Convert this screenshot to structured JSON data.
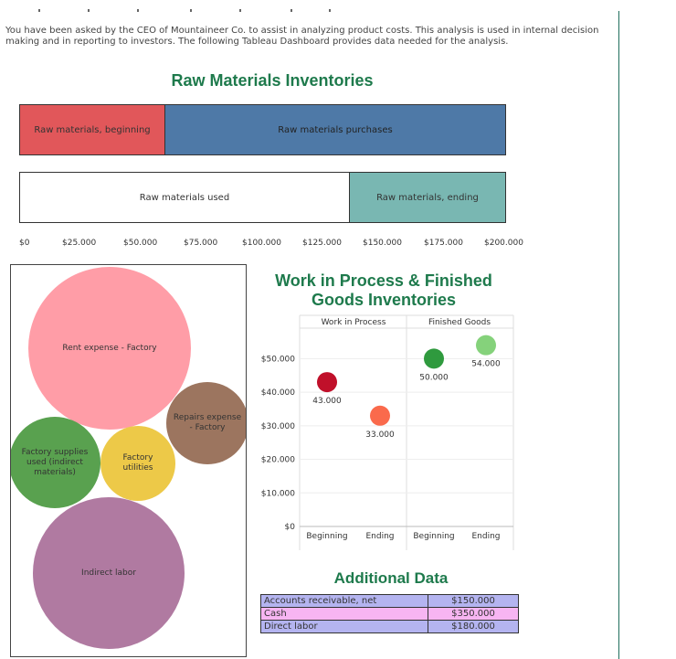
{
  "intro_text": "You have been asked by the CEO of Mountaineer Co. to assist in analyzing product costs. This analysis is used in internal decision making and in reporting to investors. The following Tableau Dashboard provides data needed for the analysis.",
  "raw_materials": {
    "title": "Raw Materials Inventories",
    "row1": {
      "left_label": "Raw materials, beginning",
      "right_label": "Raw materials purchases"
    },
    "row2": {
      "left_label": "Raw materials used",
      "right_label": "Raw materials, ending"
    },
    "colors": {
      "beginning": "#e1575a",
      "purchases": "#4e79a7",
      "used": "#ffffff",
      "ending": "#79b7b2"
    },
    "axis_ticks": [
      "$0",
      "$25.000",
      "$50.000",
      "$75.000",
      "$100.000",
      "$125.000",
      "$150.000",
      "$175.000",
      "$200.000"
    ]
  },
  "overhead_bubbles": [
    {
      "label": "Rent expense - Factory",
      "color": "#ff9da7"
    },
    {
      "label": "Repairs expense - Factory",
      "color": "#9c755f"
    },
    {
      "label": "Factory supplies used (indirect materials)",
      "color": "#59a14f"
    },
    {
      "label": "Factory utilities",
      "color": "#edc948"
    },
    {
      "label": "Indirect labor",
      "color": "#b07aa1"
    }
  ],
  "wip_fg": {
    "title_line1": "Work in Process & Finished",
    "title_line2": "Goods Inventories",
    "panel_headers": [
      "Work in Process",
      "Finished Goods"
    ],
    "y_ticks": [
      "$50.000",
      "$40.000",
      "$30.000",
      "$20.000",
      "$10.000",
      "$0"
    ],
    "x_labels": [
      "Beginning",
      "Ending",
      "Beginning",
      "Ending"
    ]
  },
  "chart_data": {
    "type": "scatter",
    "title": "Work in Process & Finished Goods Inventories",
    "panels": [
      "Work in Process",
      "Finished Goods"
    ],
    "categories": [
      "Beginning",
      "Ending"
    ],
    "ylim": [
      0,
      60000
    ],
    "points": [
      {
        "panel": "Work in Process",
        "x": "Beginning",
        "y": 43000,
        "label": "43.000",
        "color": "#c0102a"
      },
      {
        "panel": "Work in Process",
        "x": "Ending",
        "y": 33000,
        "label": "33.000",
        "color": "#fa6a4c"
      },
      {
        "panel": "Finished Goods",
        "x": "Beginning",
        "y": 50000,
        "label": "50.000",
        "color": "#2f9a3e"
      },
      {
        "panel": "Finished Goods",
        "x": "Ending",
        "y": 54000,
        "label": "54.000",
        "color": "#85d27b"
      }
    ]
  },
  "additional_data": {
    "title": "Additional Data",
    "rows": [
      {
        "label": "Accounts receivable, net",
        "value": "$150.000",
        "color": "#b4b4f0"
      },
      {
        "label": "Cash",
        "value": "$350.000",
        "color": "#f7b5f2"
      },
      {
        "label": "Direct labor",
        "value": "$180.000",
        "color": "#b4b4f0"
      }
    ]
  }
}
